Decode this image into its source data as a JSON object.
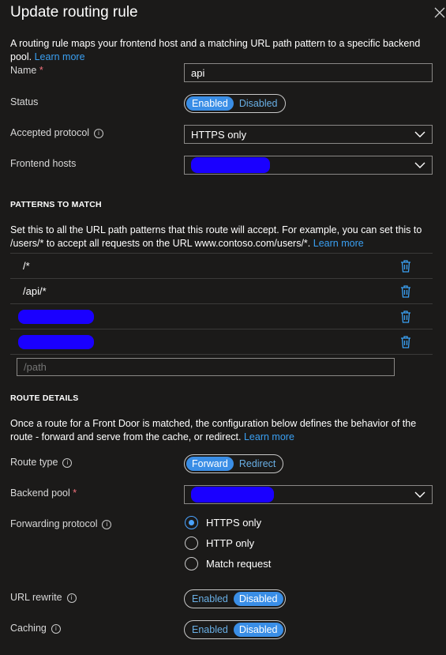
{
  "header": {
    "title": "Update routing rule",
    "close_icon": "close-icon"
  },
  "intro": {
    "text": "A routing rule maps your frontend host and a matching URL path pattern to a specific backend pool.",
    "link": "Learn more"
  },
  "form": {
    "name_label": "Name",
    "required_mark": "*",
    "name_value": "api",
    "status_label": "Status",
    "status_options": [
      "Enabled",
      "Disabled"
    ],
    "status_selected": "Enabled",
    "protocol_label": "Accepted protocol",
    "protocol_value": "HTTPS only",
    "frontend_label": "Frontend hosts"
  },
  "patterns": {
    "heading": "PATTERNS TO MATCH",
    "text": "Set this to all the URL path patterns that this route will accept. For example, you can set this to /users/* to accept all requests on the URL www.contoso.com/users/*.",
    "link": "Learn more",
    "items": [
      "/*",
      "/api/*"
    ],
    "placeholder": "/path"
  },
  "route": {
    "heading": "ROUTE DETAILS",
    "text": "Once a route for a Front Door is matched, the configuration below defines the behavior of the route - forward and serve from the cache, or redirect.",
    "link": "Learn more",
    "type_label": "Route type",
    "type_options": [
      "Forward",
      "Redirect"
    ],
    "type_selected": "Forward",
    "backend_label": "Backend pool",
    "fwd_label": "Forwarding protocol",
    "fwd_options": [
      "HTTPS only",
      "HTTP only",
      "Match request"
    ],
    "fwd_selected": "HTTPS only",
    "rewrite_label": "URL rewrite",
    "rewrite_options": [
      "Enabled",
      "Disabled"
    ],
    "rewrite_selected": "Disabled",
    "caching_label": "Caching",
    "caching_options": [
      "Enabled",
      "Disabled"
    ],
    "caching_selected": "Disabled"
  },
  "colors": {
    "accent": "#3a8ee6",
    "link": "#3aa0f3",
    "background": "#1b1a19",
    "redaction": "#1a00ff"
  }
}
